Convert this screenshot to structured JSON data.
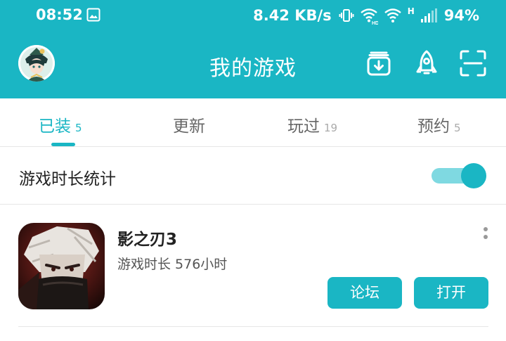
{
  "status_bar": {
    "time": "08:52",
    "net_speed": "8.42 KB/s",
    "network_type": "H",
    "battery": "94%"
  },
  "header": {
    "title": "我的游戏"
  },
  "tabs": [
    {
      "label": "已装",
      "count": "5",
      "active": true
    },
    {
      "label": "更新",
      "count": "",
      "active": false
    },
    {
      "label": "玩过",
      "count": "19",
      "active": false
    },
    {
      "label": "预约",
      "count": "5",
      "active": false
    }
  ],
  "settings": {
    "playtime_stats_label": "游戏时长统计",
    "playtime_stats_enabled": true
  },
  "games": [
    {
      "name": "影之刃3",
      "playtime": "游戏时长 576小时",
      "forum_label": "论坛",
      "open_label": "打开"
    }
  ],
  "colors": {
    "accent": "#1AB6C4",
    "toggle_track": "#7FD9E1",
    "text_primary": "#222222",
    "text_secondary": "#666666"
  },
  "icons": {
    "status_left": [
      "image-icon"
    ],
    "status_right": [
      "vibrate-icon",
      "wifi-calling-icon",
      "wifi-icon",
      "signal-icon"
    ],
    "toolbar": [
      "download-box-icon",
      "rocket-icon",
      "scan-icon"
    ],
    "card": [
      "more-vertical-icon"
    ]
  }
}
